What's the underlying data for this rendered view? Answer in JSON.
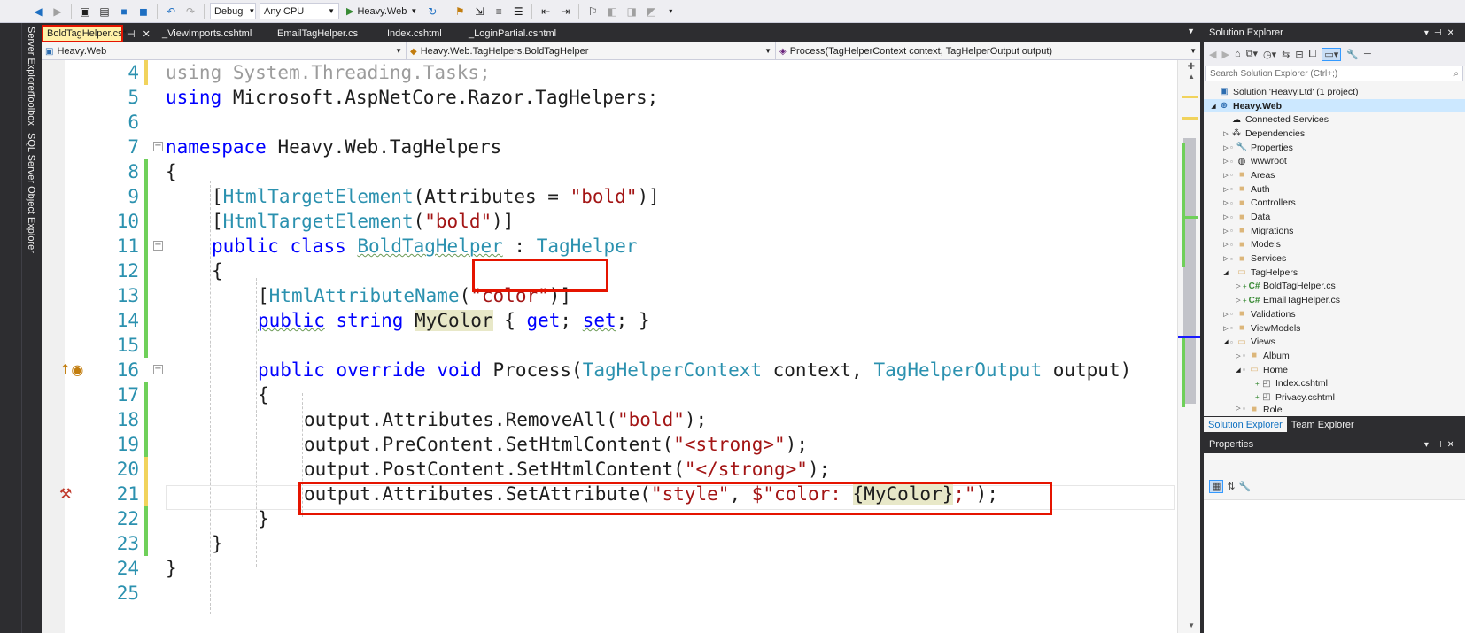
{
  "toolbar": {
    "configuration": "Debug",
    "platform": "Any CPU",
    "run_target": "Heavy.Web"
  },
  "side_tool_windows": [
    "Server Explorer",
    "Toolbox",
    "SQL Server Object Explorer"
  ],
  "tabs": [
    {
      "label": "BoldTagHelper.cs*",
      "active": true
    },
    {
      "label": "_ViewImports.cshtml"
    },
    {
      "label": "EmailTagHelper.cs"
    },
    {
      "label": "Index.cshtml"
    },
    {
      "label": "_LoginPartial.cshtml"
    }
  ],
  "navbar": {
    "project": "Heavy.Web",
    "type": "Heavy.Web.TagHelpers.BoldTagHelper",
    "member": "Process(TagHelperContext context, TagHelperOutput output)"
  },
  "editor": {
    "line_numbers": [
      "4",
      "5",
      "6",
      "7",
      "8",
      "9",
      "10",
      "11",
      "12",
      "13",
      "14",
      "15",
      "16",
      "17",
      "18",
      "19",
      "20",
      "21",
      "22",
      "23",
      "24",
      "25"
    ],
    "code": {
      "l4": [
        "using System.Threading.Tasks;"
      ],
      "l5": [
        "using",
        " Microsoft.AspNetCore.Razor.TagHelpers;"
      ],
      "l7": [
        "namespace",
        " Heavy.Web.TagHelpers"
      ],
      "l8": [
        "{"
      ],
      "l9": [
        "[",
        "HtmlTargetElement",
        "(Attributes = ",
        "\"bold\"",
        ")]"
      ],
      "l10": [
        "[",
        "HtmlTargetElement",
        "(",
        "\"bold\"",
        ")]"
      ],
      "l11": [
        "public",
        " ",
        "class",
        " ",
        "BoldTagHelper",
        " : ",
        "TagHelper"
      ],
      "l12": [
        "{"
      ],
      "l13": [
        "[",
        "HtmlAttributeName",
        "(",
        "\"color\"",
        ")]"
      ],
      "l14": [
        "public",
        " ",
        "string",
        " ",
        "MyColor",
        " { ",
        "get",
        "; ",
        "set",
        "; }"
      ],
      "l16": [
        "public",
        " ",
        "override",
        " ",
        "void",
        " Process(",
        "TagHelperContext",
        " context, ",
        "TagHelperOutput",
        " output)"
      ],
      "l17": [
        "{"
      ],
      "l18": [
        "output.Attributes.RemoveAll(",
        "\"bold\"",
        ");"
      ],
      "l19": [
        "output.PreContent.SetHtmlContent(",
        "\"<strong>\"",
        ");"
      ],
      "l20": [
        "output.PostContent.SetHtmlContent(",
        "\"</strong>\"",
        ");"
      ],
      "l21": [
        "output.Attributes.SetAttribute(",
        "\"style\"",
        ", ",
        "$\"color: ",
        "{",
        "MyCol",
        "or",
        "}",
        ";\"",
        ");"
      ],
      "l22": [
        "}"
      ],
      "l23": [
        "}"
      ],
      "l24": [
        "}"
      ]
    }
  },
  "solution_explorer": {
    "title": "Solution Explorer",
    "search_placeholder": "Search Solution Explorer (Ctrl+;)",
    "items": [
      {
        "label": "Solution 'Heavy.Ltd' (1 project)"
      },
      {
        "label": "Heavy.Web"
      },
      {
        "label": "Connected Services"
      },
      {
        "label": "Dependencies"
      },
      {
        "label": "Properties"
      },
      {
        "label": "wwwroot"
      },
      {
        "label": "Areas"
      },
      {
        "label": "Auth"
      },
      {
        "label": "Controllers"
      },
      {
        "label": "Data"
      },
      {
        "label": "Migrations"
      },
      {
        "label": "Models"
      },
      {
        "label": "Services"
      },
      {
        "label": "TagHelpers"
      },
      {
        "label": "BoldTagHelper.cs"
      },
      {
        "label": "EmailTagHelper.cs"
      },
      {
        "label": "Validations"
      },
      {
        "label": "ViewModels"
      },
      {
        "label": "Views"
      },
      {
        "label": "Album"
      },
      {
        "label": "Home"
      },
      {
        "label": "Index.cshtml"
      },
      {
        "label": "Privacy.cshtml"
      },
      {
        "label": "Role"
      }
    ],
    "bottom_tabs": [
      "Solution Explorer",
      "Team Explorer"
    ]
  },
  "properties": {
    "title": "Properties"
  }
}
